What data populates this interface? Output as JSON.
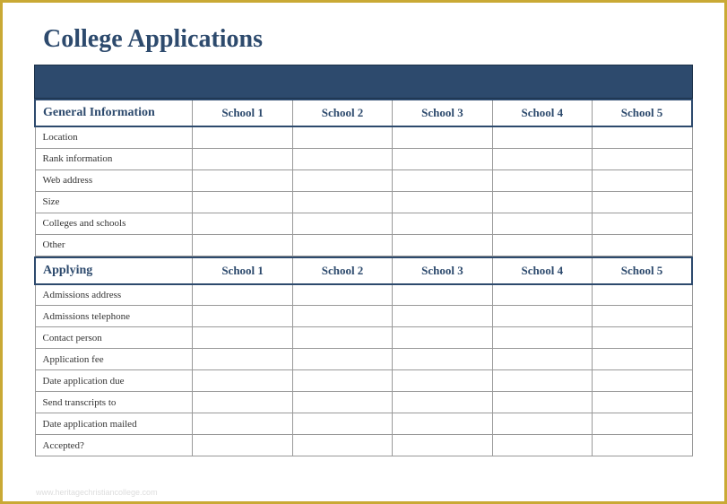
{
  "title": "College Applications",
  "sections": [
    {
      "name": "General Information",
      "columns": [
        "School 1",
        "School 2",
        "School 3",
        "School 4",
        "School 5"
      ],
      "rows": [
        {
          "label": "Location",
          "cells": [
            "",
            "",
            "",
            "",
            ""
          ]
        },
        {
          "label": "Rank information",
          "cells": [
            "",
            "",
            "",
            "",
            ""
          ]
        },
        {
          "label": "Web address",
          "cells": [
            "",
            "",
            "",
            "",
            ""
          ]
        },
        {
          "label": "Size",
          "cells": [
            "",
            "",
            "",
            "",
            ""
          ]
        },
        {
          "label": "Colleges and schools",
          "cells": [
            "",
            "",
            "",
            "",
            ""
          ]
        },
        {
          "label": "Other",
          "cells": [
            "",
            "",
            "",
            "",
            ""
          ]
        }
      ]
    },
    {
      "name": "Applying",
      "columns": [
        "School 1",
        "School 2",
        "School 3",
        "School 4",
        "School 5"
      ],
      "rows": [
        {
          "label": "Admissions address",
          "cells": [
            "",
            "",
            "",
            "",
            ""
          ]
        },
        {
          "label": "Admissions telephone",
          "cells": [
            "",
            "",
            "",
            "",
            ""
          ]
        },
        {
          "label": "Contact person",
          "cells": [
            "",
            "",
            "",
            "",
            ""
          ]
        },
        {
          "label": "Application fee",
          "cells": [
            "",
            "",
            "",
            "",
            ""
          ]
        },
        {
          "label": "Date application due",
          "cells": [
            "",
            "",
            "",
            "",
            ""
          ]
        },
        {
          "label": "Send transcripts to",
          "cells": [
            "",
            "",
            "",
            "",
            ""
          ]
        },
        {
          "label": "Date application mailed",
          "cells": [
            "",
            "",
            "",
            "",
            ""
          ]
        },
        {
          "label": "Accepted?",
          "cells": [
            "",
            "",
            "",
            "",
            ""
          ]
        }
      ]
    }
  ],
  "watermark": "www.heritagechristiancollege.com"
}
